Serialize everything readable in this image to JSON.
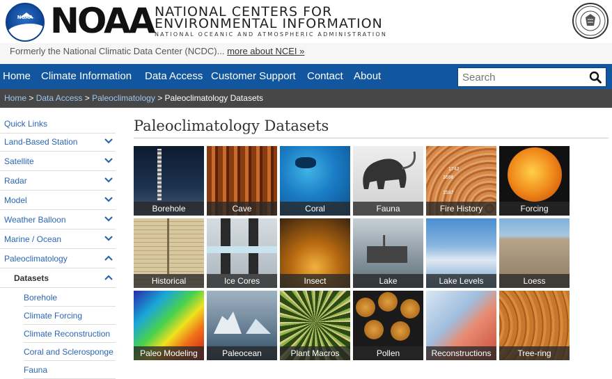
{
  "header": {
    "logo_text": "NOAA",
    "brand": "NOAA",
    "ncei_line1": "NATIONAL CENTERS FOR",
    "ncei_line2": "ENVIRONMENTAL INFORMATION",
    "ncei_line3": "NATIONAL OCEANIC AND ATMOSPHERIC ADMINISTRATION",
    "seal_text": "DEPARTMENT OF COMMERCE · UNITED STATES OF AMERICA"
  },
  "formerly": {
    "text": "Formerly the National Climatic Data Center (NCDC)... ",
    "link": "more about NCEI »"
  },
  "nav": {
    "items": [
      "Home",
      "Climate Information",
      "Data Access",
      "Customer Support",
      "Contact",
      "About"
    ],
    "search_placeholder": "Search"
  },
  "breadcrumb": {
    "items": [
      "Home",
      "Data Access",
      "Paleoclimatology"
    ],
    "separator": ">",
    "current": "Paleoclimatology Datasets"
  },
  "sidebar": {
    "items": [
      "Quick Links",
      "Land-Based Station",
      "Satellite",
      "Radar",
      "Model",
      "Weather Balloon",
      "Marine / Ocean",
      "Paleoclimatology",
      "Datasets"
    ],
    "sub_items": [
      "Borehole",
      "Climate Forcing",
      "Climate Reconstruction",
      "Coral and Sclerosponge",
      "Fauna"
    ]
  },
  "main": {
    "title": "Paleoclimatology Datasets",
    "tiles": [
      "Borehole",
      "Cave",
      "Coral",
      "Fauna",
      "Fire History",
      "Forcing",
      "Historical",
      "Ice Cores",
      "Insect",
      "Lake",
      "Lake Levels",
      "Loess",
      "Paleo Modeling",
      "Paleocean",
      "Plant Macros",
      "Pollen",
      "Reconstructions",
      "Tree-ring"
    ],
    "fire_history_marks": [
      "1742",
      "1698",
      "1597"
    ]
  },
  "colors": {
    "nav_blue": "#1256a0",
    "breadcrumb_gray": "#474747",
    "link_blue": "#2b66b3"
  }
}
